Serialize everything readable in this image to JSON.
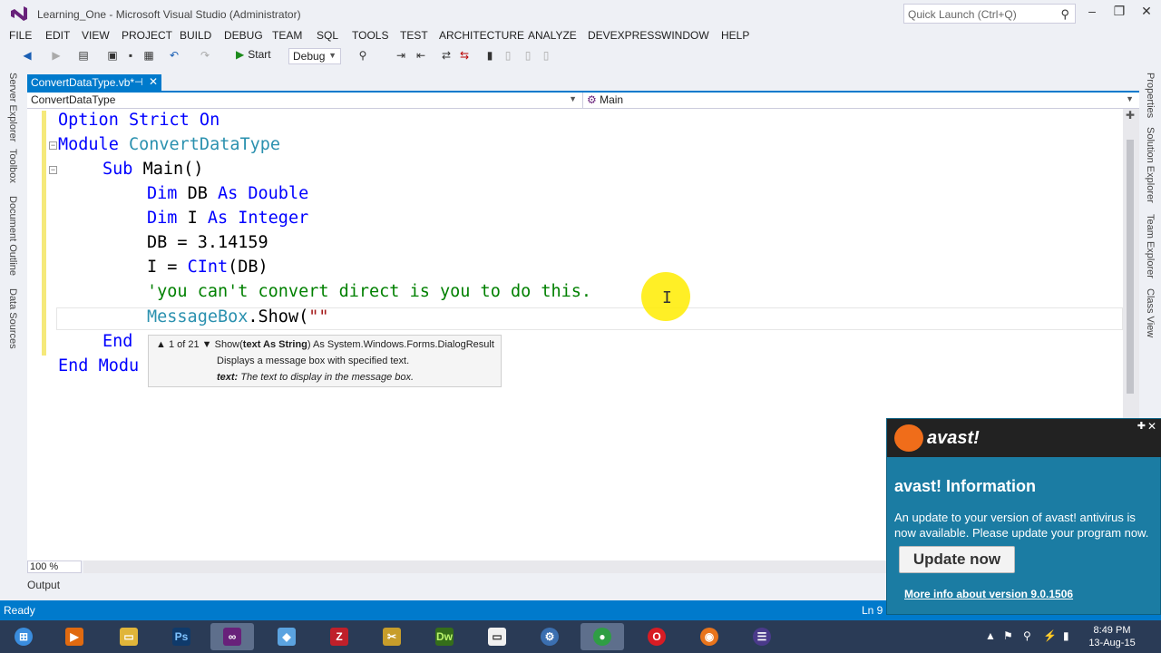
{
  "window": {
    "title": "Learning_One - Microsoft Visual Studio (Administrator)",
    "quick_launch_placeholder": "Quick Launch (Ctrl+Q)"
  },
  "menu": [
    "FILE",
    "EDIT",
    "VIEW",
    "PROJECT",
    "BUILD",
    "DEBUG",
    "TEAM",
    "SQL",
    "TOOLS",
    "TEST",
    "ARCHITECTURE",
    "ANALYZE",
    "DEVEXPRESS",
    "WINDOW",
    "HELP"
  ],
  "toolbar": {
    "start_label": "Start",
    "config": "Debug"
  },
  "left_dock": [
    "Server Explorer",
    "Toolbox",
    "Document Outline",
    "Data Sources"
  ],
  "right_dock": [
    "Properties",
    "Solution Explorer",
    "Team Explorer",
    "Class View"
  ],
  "doc_tab": {
    "label": "ConvertDataType.vb*"
  },
  "navbar": {
    "left": "ConvertDataType",
    "right": "Main"
  },
  "code": {
    "l1_kw": "Option Strict On",
    "l2_kw": "Module",
    "l2_type": "ConvertDataType",
    "l3_kw": "Sub",
    "l3_rest": "Main()",
    "l4_kw1": "Dim",
    "l4_mid": "DB",
    "l4_kw2": "As Double",
    "l5_kw1": "Dim",
    "l5_mid": "I",
    "l5_kw2": "As Integer",
    "l6": "DB = 3.14159",
    "l7_pre": "I = ",
    "l7_kw": "CInt",
    "l7_post": "(DB)",
    "l8_comment": "'you can't convert direct is you to do this.",
    "l9_type": "MessageBox",
    "l9_rest": ".Show(",
    "l9_str": "\"\"",
    "l10_kw": "End",
    "l11_kw": "End",
    "l11_rest": "Modu"
  },
  "tooltip": {
    "counter": "1 of 21",
    "signature_pre": "Show(",
    "signature_param": "text As String",
    "signature_post": ") As System.Windows.Forms.DialogResult",
    "description": "Displays a message box with specified text.",
    "param_name": "text:",
    "param_desc": "The text to display in the message box."
  },
  "zoom": "100 %",
  "output_tab": "Output",
  "status": {
    "ready": "Ready",
    "line": "Ln 9"
  },
  "avast": {
    "brand": "avast!",
    "title": "avast! Information",
    "message": "An update to your version of avast! antivirus is now available. Please update your program now.",
    "button": "Update now",
    "link": "More info about version 9.0.1506"
  },
  "clock": {
    "time": "8:49 PM",
    "date": "13-Aug-15"
  },
  "colors": {
    "accent": "#007acc",
    "avast_bg": "#1b7ca3",
    "taskbar": "#2a3b56"
  }
}
